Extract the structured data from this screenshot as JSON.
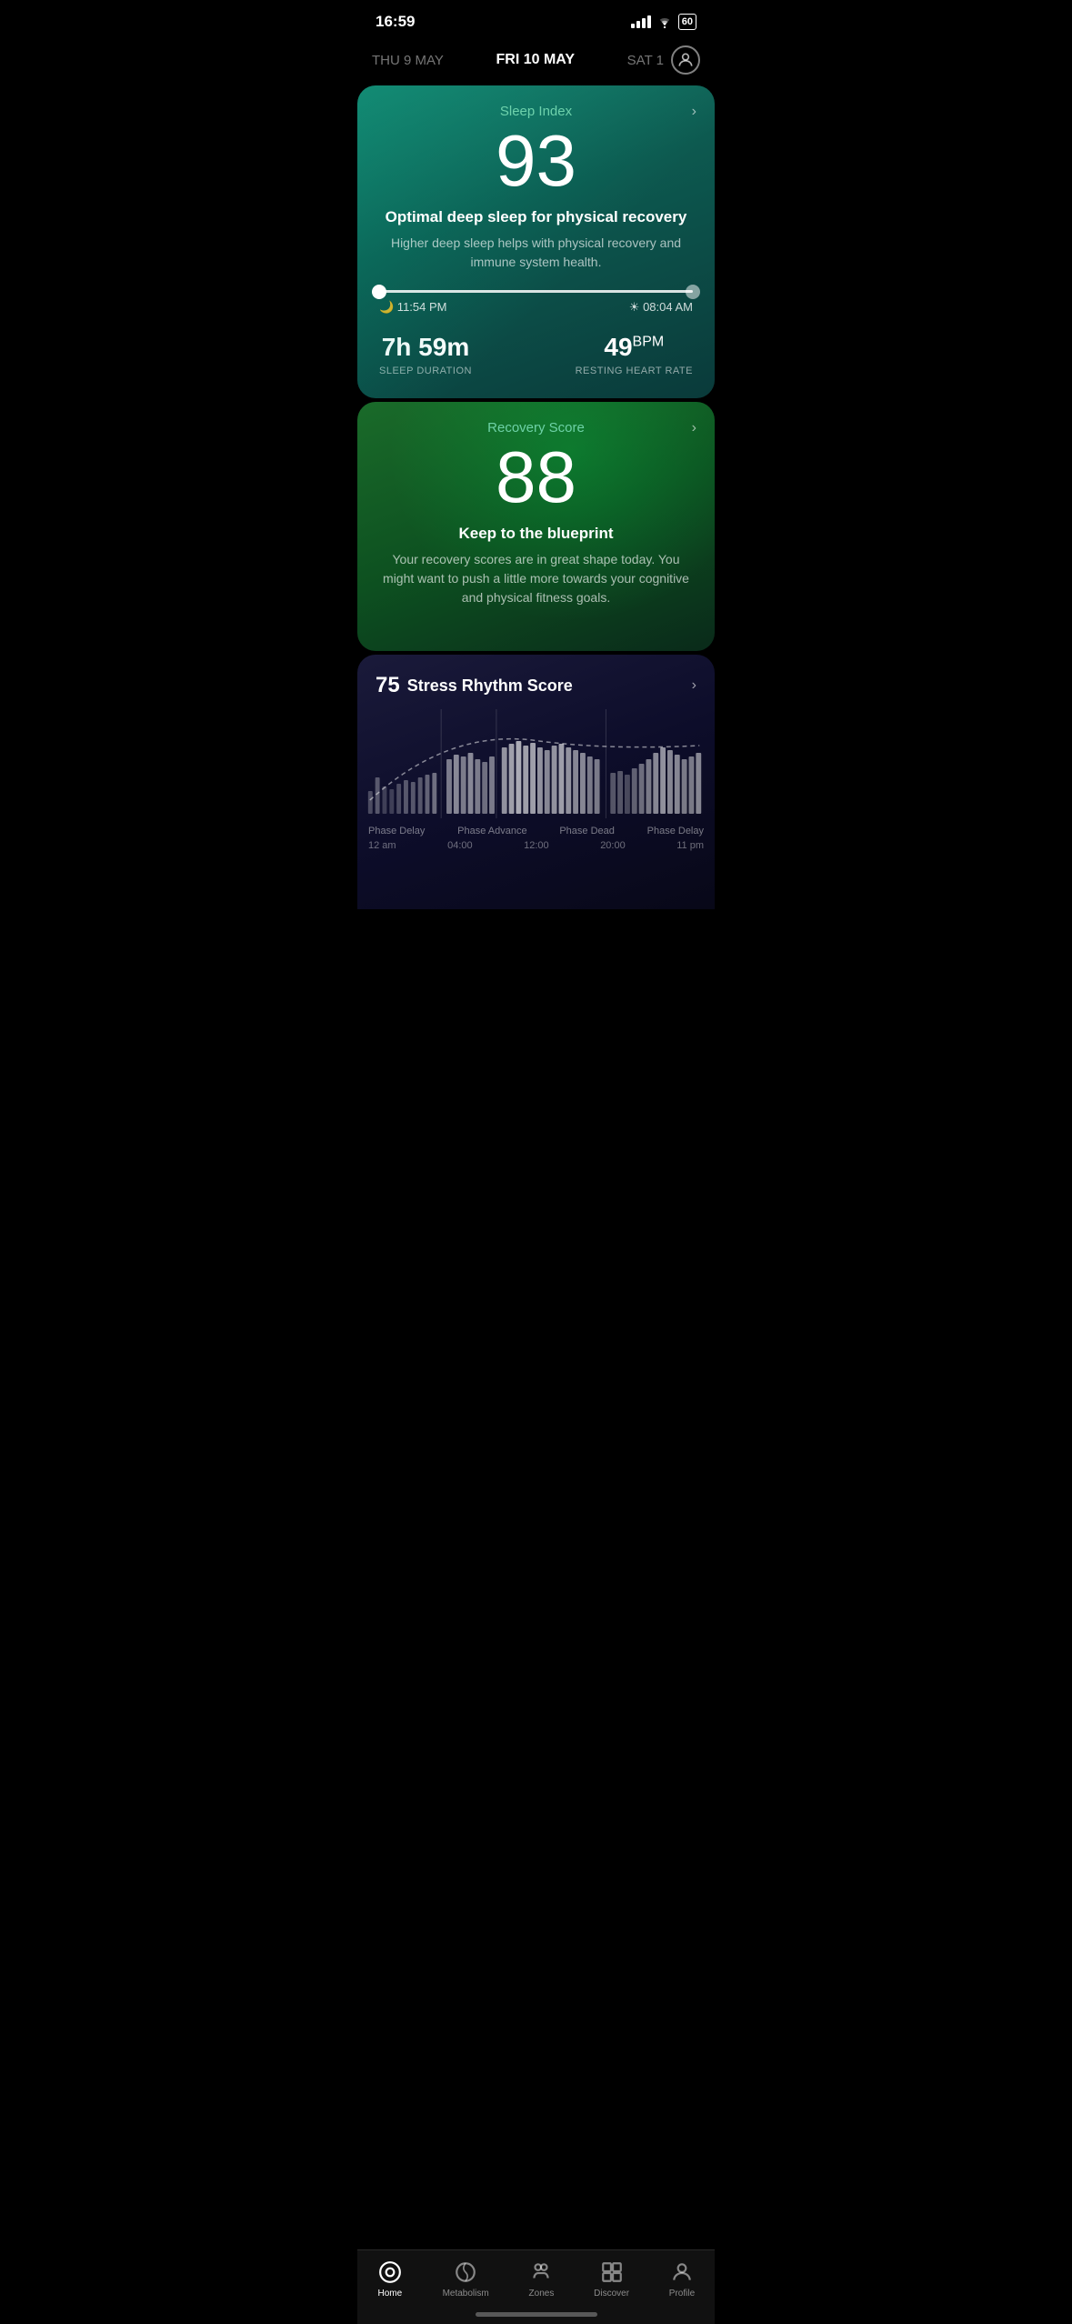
{
  "statusBar": {
    "time": "16:59",
    "battery": "60"
  },
  "dateNav": {
    "prev": "THU 9 MAY",
    "current": "FRI 10 MAY",
    "next": "SAT 1"
  },
  "sleepCard": {
    "label": "Sleep Index",
    "score": "93",
    "headline": "Optimal deep sleep for physical recovery",
    "description": "Higher deep sleep helps with physical recovery and immune system health.",
    "sleepTime": "🌙 11:54 PM",
    "wakeTime": "☀ 08:04 AM",
    "duration": "7h 59m",
    "durationLabel": "SLEEP DURATION",
    "heartRate": "49",
    "heartRateUnit": "BPM",
    "heartRateLabel": "RESTING HEART RATE"
  },
  "recoveryCard": {
    "label": "Recovery Score",
    "score": "88",
    "headline": "Keep to the blueprint",
    "description": "Your recovery scores are in great shape today. You might want to push a little more towards your cognitive and physical fitness goals."
  },
  "stressCard": {
    "score": "75",
    "title": "Stress Rhythm Score",
    "phases": [
      "Phase Delay",
      "Phase Advance",
      "Phase Dead",
      "Phase Delay"
    ],
    "times": [
      "12 am",
      "04:00",
      "12:00",
      "20:00",
      "11 pm"
    ]
  },
  "bottomNav": {
    "items": [
      {
        "id": "home",
        "label": "Home",
        "active": true
      },
      {
        "id": "metabolism",
        "label": "Metabolism",
        "active": false
      },
      {
        "id": "zones",
        "label": "Zones",
        "active": false
      },
      {
        "id": "discover",
        "label": "Discover",
        "active": false
      },
      {
        "id": "profile",
        "label": "Profile",
        "active": false
      }
    ]
  }
}
